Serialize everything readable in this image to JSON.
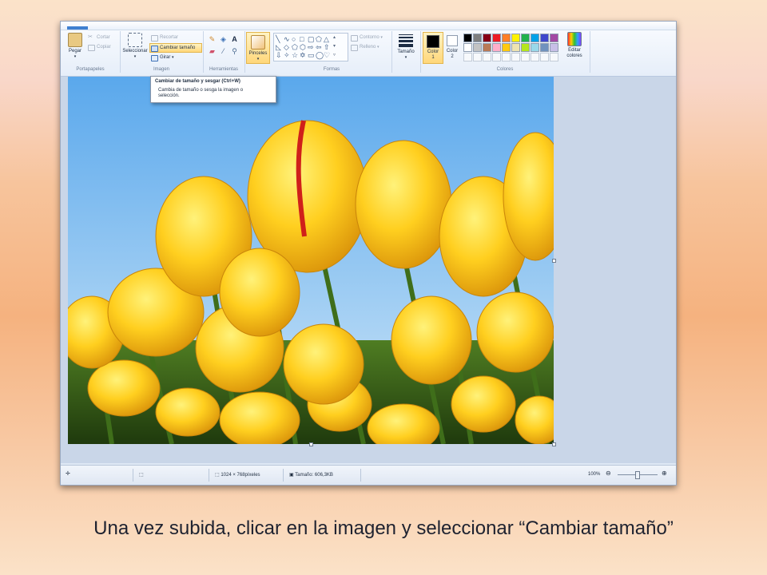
{
  "ribbon": {
    "portapapeles": {
      "label": "Portapapeles",
      "pegar": "Pegar",
      "cortar": "Cortar",
      "copiar": "Copiar"
    },
    "imagen": {
      "label": "Imagen",
      "seleccionar": "Seleccionar",
      "recortar": "Recortar",
      "cambiar_tamano": "Cambiar tamaño",
      "girar": "Girar"
    },
    "herramientas": {
      "label": "Herramientas",
      "text_tool": "A"
    },
    "pinceles": "Pinceles",
    "formas": {
      "label": "Formas",
      "contorno": "Contorno",
      "rellenar": "Relleno"
    },
    "tamano": "Tamaño",
    "colores": {
      "label": "Colores",
      "color1_line1": "Color",
      "color1_line2": "1",
      "color2_line1": "Color",
      "color2_line2": "2",
      "editar_line1": "Editar",
      "editar_line2": "colores",
      "palette_row1": [
        "#000000",
        "#7f7f7f",
        "#880015",
        "#ed1c24",
        "#ff7f27",
        "#fff200",
        "#22b14c",
        "#00a2e8",
        "#3f48cc",
        "#a349a4"
      ],
      "palette_row2": [
        "#ffffff",
        "#c3c3c3",
        "#b97a57",
        "#ffaec9",
        "#ffc90e",
        "#efe4b0",
        "#b5e61d",
        "#99d9ea",
        "#7092be",
        "#c8bfe7"
      ]
    }
  },
  "tooltip": {
    "title": "Cambiar de tamaño y sesgar (Ctrl+W)",
    "desc_line1": "Cambia de tamaño o sesga la imagen o",
    "desc_line2": "selección."
  },
  "status": {
    "dimensions": "1024 × 768píxeles",
    "size": "Tamaño: 606,3KB",
    "zoom": "100%"
  },
  "caption": "Una vez subida, clicar en la imagen y seleccionar “Cambiar tamaño”"
}
